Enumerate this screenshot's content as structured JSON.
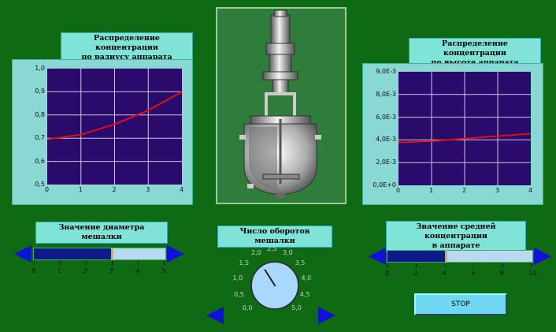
{
  "left_chart": {
    "title_line1": "Распределение концентрации",
    "title_line2": "по радиусу аппарата",
    "y_ticks": [
      "1,0",
      "0,9",
      "0,8",
      "0,7",
      "0,6",
      "0,5"
    ],
    "x_ticks": [
      "0",
      "1",
      "2",
      "3",
      "4"
    ],
    "line_color": "#e01010"
  },
  "right_chart": {
    "title_line1": "Распределение концентрации",
    "title_line2": "по высоте аппарата",
    "y_ticks": [
      "9,0E-3",
      "8,0E-3",
      "6,0E-3",
      "4,0E-3",
      "2,0E-3",
      "0,0E+0"
    ],
    "x_ticks": [
      "0",
      "1",
      "2",
      "3",
      "4"
    ],
    "line_color": "#e01010"
  },
  "chart_data": [
    {
      "type": "line",
      "x": [
        0,
        1,
        2,
        3,
        4
      ],
      "series": [
        {
          "values": [
            0.695,
            0.715,
            0.76,
            0.82,
            0.9
          ]
        }
      ],
      "xlim": [
        0,
        4
      ],
      "ylim": [
        0.5,
        1.0
      ],
      "grid": true
    },
    {
      "type": "line",
      "x": [
        0,
        1,
        2,
        3,
        4
      ],
      "series": [
        {
          "values": [
            0.0034,
            0.0035,
            0.0037,
            0.0039,
            0.0041
          ]
        }
      ],
      "xlim": [
        0,
        4
      ],
      "ylim": [
        0,
        0.009
      ],
      "grid": true
    }
  ],
  "diameter_slider": {
    "label": "Значение диаметра мешалки",
    "ticks": [
      "0",
      "1",
      "2",
      "3",
      "4",
      "5"
    ],
    "value": 3,
    "max": 5
  },
  "speed_dial": {
    "label": "Число оборотов мешалки",
    "ticks": [
      "0,0",
      "0,5",
      "1,0",
      "1,5",
      "2,0",
      "2,5",
      "3,0",
      "3,5",
      "4,0",
      "4,5",
      "5,0"
    ],
    "value": 1.9
  },
  "concentration_slider": {
    "label_line1": "Значение средней концентрации",
    "label_line2": "в аппарате",
    "ticks": [
      "0",
      "2",
      "4",
      "6",
      "8",
      "10"
    ],
    "value": 4.1,
    "max": 10
  },
  "stop_button": {
    "label": "STOP"
  },
  "colors": {
    "background": "#0e6b14",
    "plot_bg": "#2a0a6b",
    "panel": "#89d8d4",
    "arrow": "#1010d8"
  }
}
